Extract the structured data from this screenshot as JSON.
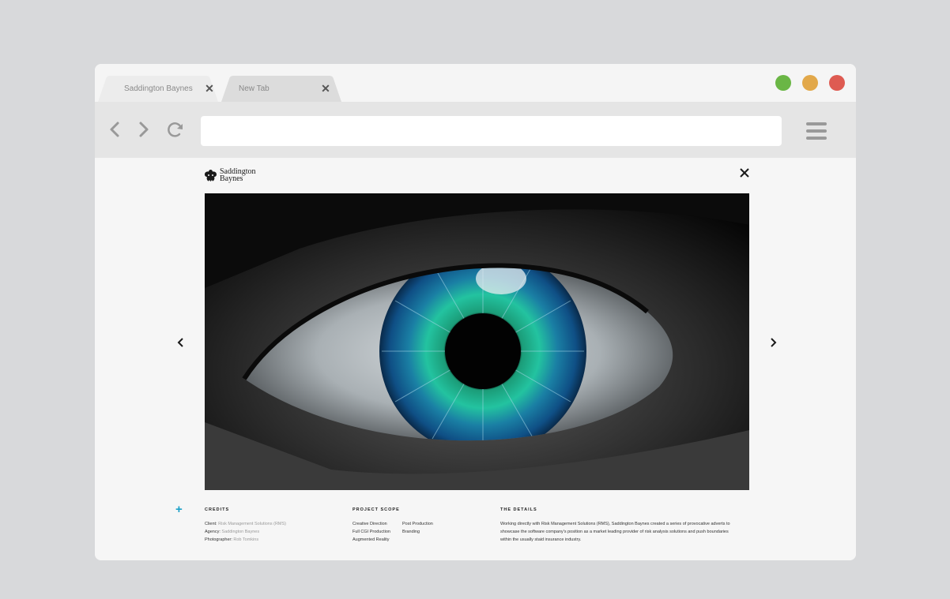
{
  "tabs": [
    {
      "label": "Saddington Baynes",
      "close": "✕"
    },
    {
      "label": "New Tab",
      "close": "✕"
    }
  ],
  "colors": {
    "light_green": "#6ab645",
    "light_yellow": "#e2a84a",
    "light_red": "#de5b52",
    "accent": "#1aa0c8"
  },
  "toolbar": {
    "back_icon": "chevron-left-icon",
    "forward_icon": "chevron-right-icon",
    "reload_icon": "reload-icon",
    "url_value": "",
    "menu_icon": "hamburger-menu-icon"
  },
  "page": {
    "logo": {
      "line1": "Saddington",
      "line2": "Baynes"
    },
    "close_icon": "close-icon",
    "hero_alt": "Close-up of a human eye with a blue-green iris",
    "expand_icon": "+",
    "credits": {
      "heading": "CREDITS",
      "rows": [
        {
          "label": "Client:",
          "value": "Risk Management Solutions (RMS)"
        },
        {
          "label": "Agency:",
          "value": "Saddington Baynes"
        },
        {
          "label": "Photographer:",
          "value": "Rob Tomkins"
        }
      ]
    },
    "scope": {
      "heading": "PROJECT SCOPE",
      "items": [
        "Creative Direction",
        "Post Production",
        "Full CGI Production",
        "Branding",
        "Augmented Reality"
      ]
    },
    "details": {
      "heading": "THE DETAILS",
      "lines": [
        "Working directly with Risk Management Solutions (RMS), Saddington Baynes created a series of provocative adverts to",
        "showcase the software company's position as a market leading provider of risk analysis solutions and push boundaries",
        "within the usually staid insurance industry."
      ]
    }
  }
}
